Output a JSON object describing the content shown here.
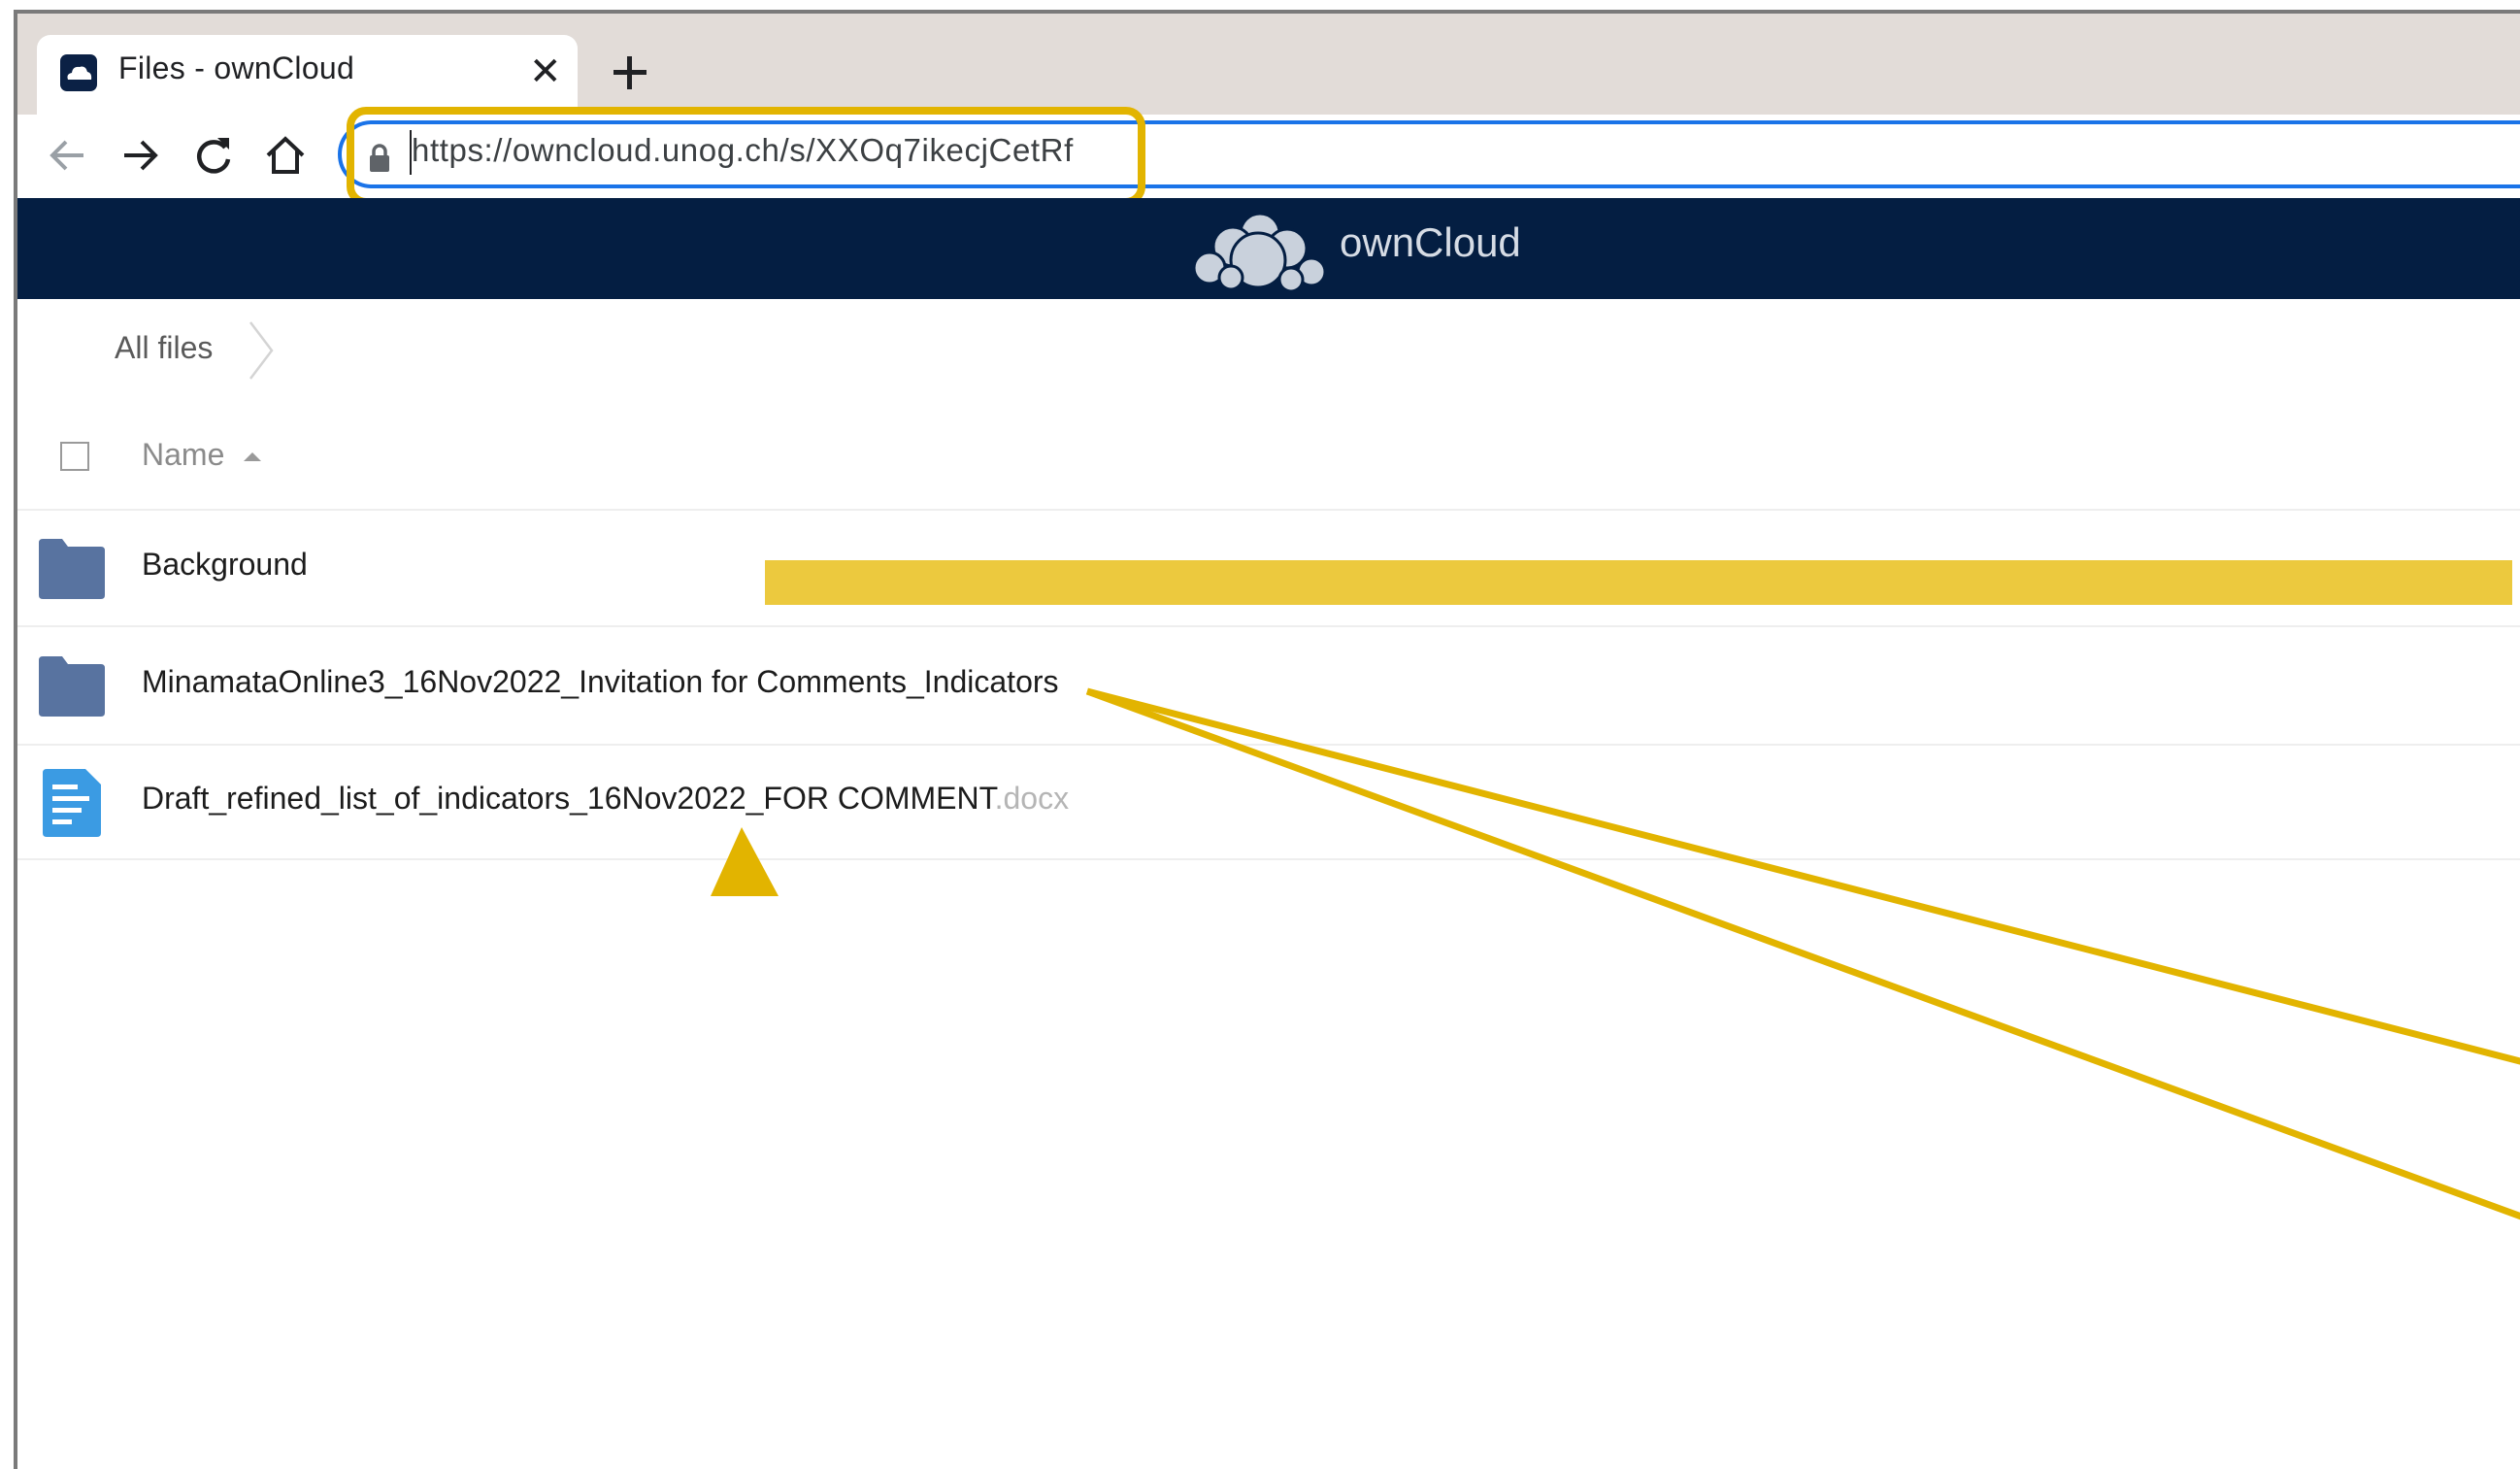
{
  "browser": {
    "tab": {
      "title": "Files - ownCloud",
      "close_glyph": "✕",
      "favicon": "owncloud-favicon-icon"
    },
    "new_tab_icon": "plus-icon",
    "toolbar": {
      "back_icon": "arrow-left-icon",
      "forward_icon": "arrow-right-icon",
      "reload_icon": "reload-icon",
      "home_icon": "home-icon"
    },
    "address_bar": {
      "url": "https://owncloud.unog.ch/s/XXOq7ikecjCetRf",
      "lock_icon": "lock-icon"
    }
  },
  "header": {
    "logo": "owncloud-logo-icon",
    "brand": "ownCloud"
  },
  "breadcrumb": {
    "home_label": "All files"
  },
  "file_list": {
    "columns": {
      "name_label": "Name",
      "sort": "ascending"
    },
    "rows": [
      {
        "type": "folder",
        "name": "Background",
        "ext": ""
      },
      {
        "type": "folder",
        "name": "MinamataOnline3_16Nov2022_Invitation for Comments_Indicators",
        "ext": ""
      },
      {
        "type": "document",
        "name": "Draft_refined_list_of_indicators_16Nov2022_FOR COMMENT",
        "ext": ".docx"
      }
    ]
  },
  "annotations": {
    "highlight_color": "#e2b400",
    "bar_color": "#ecc93e"
  },
  "colors": {
    "header_bg": "#041e42",
    "folder": "#5873a0",
    "doc": "#3b9be3",
    "address_focus": "#1a73e8"
  }
}
